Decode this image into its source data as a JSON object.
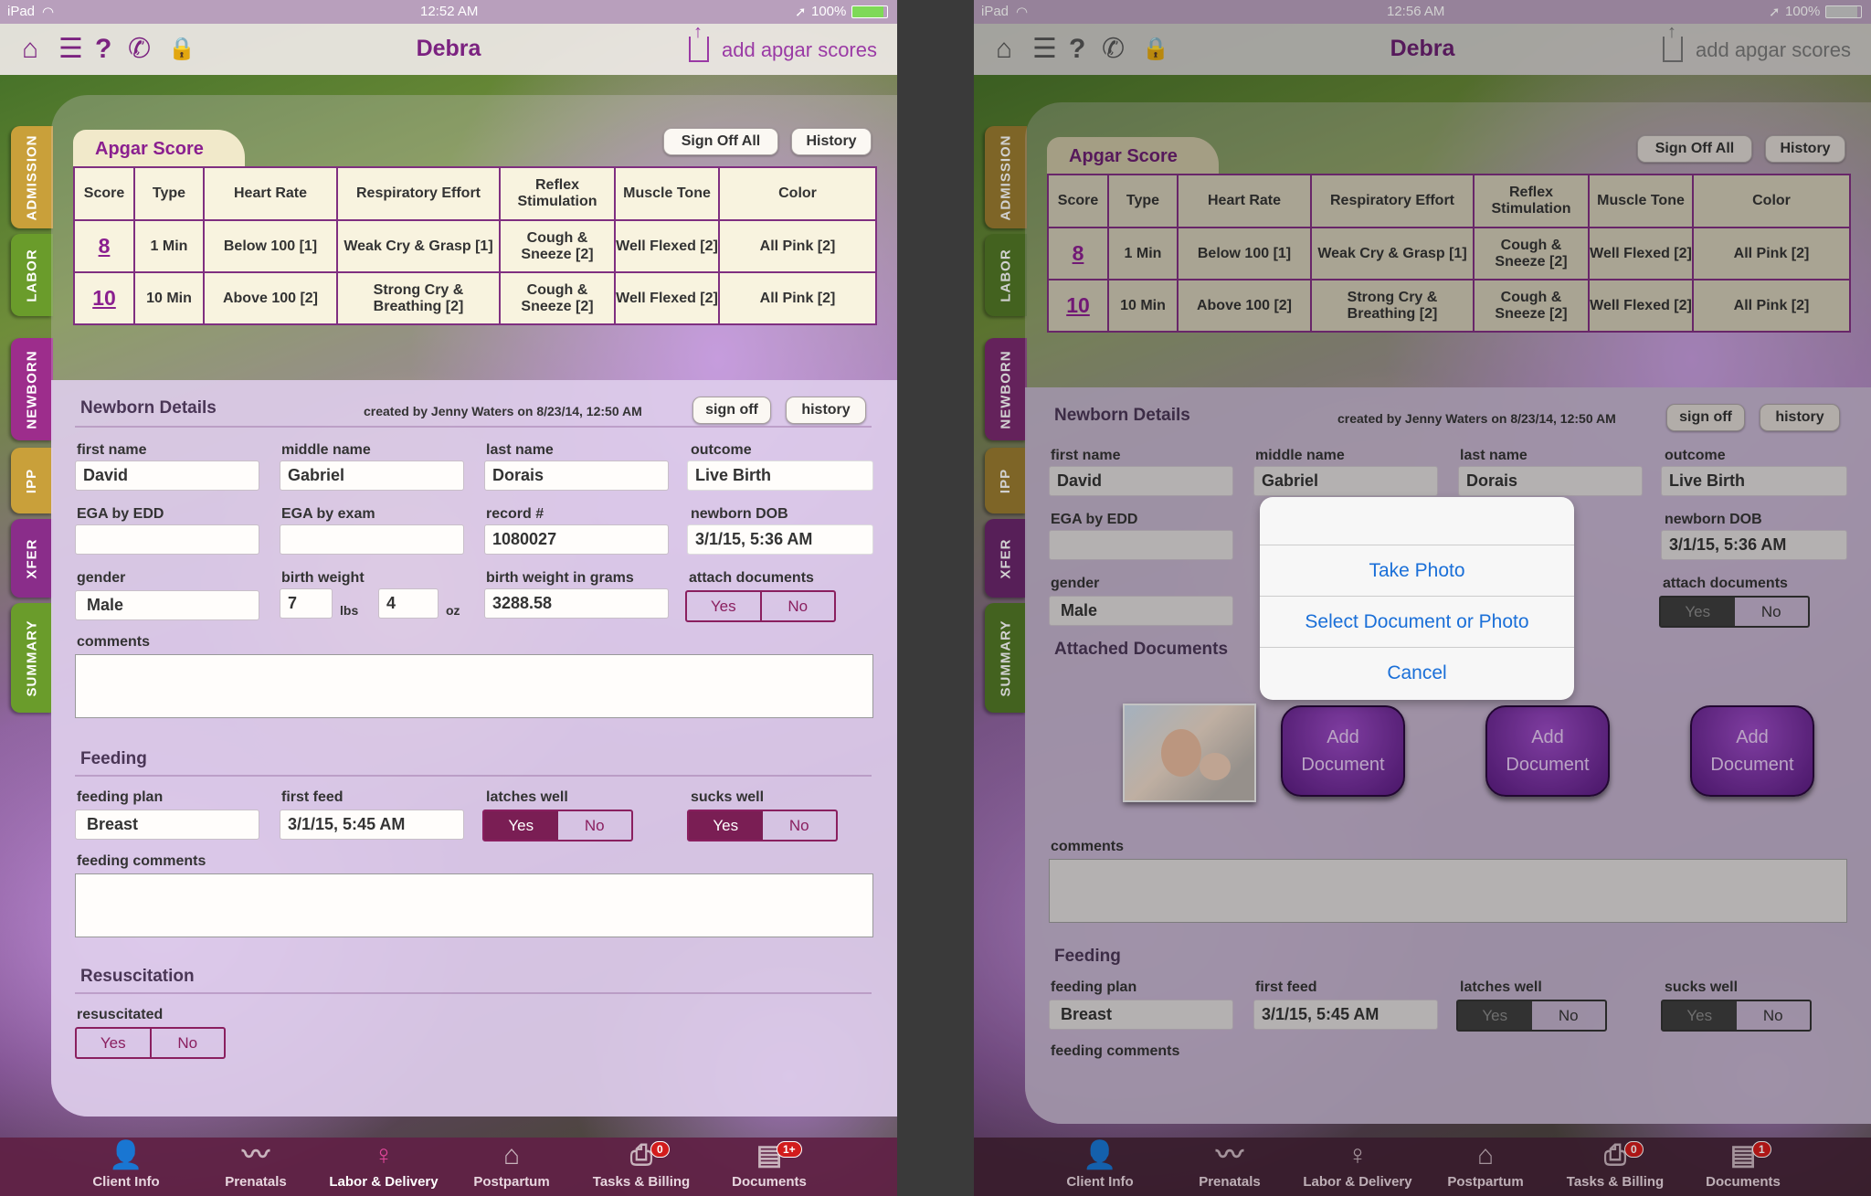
{
  "status_left": {
    "device": "iPad",
    "time": "12:52 AM",
    "battery": "100%"
  },
  "status_right": {
    "device": "iPad",
    "time": "12:56 AM",
    "battery": "100%"
  },
  "nav": {
    "title": "Debra",
    "action": "add apgar scores"
  },
  "sidetabs": [
    "ADMISSION",
    "LABOR",
    "NEWBORN",
    "IPP",
    "XFER",
    "SUMMARY"
  ],
  "apgar": {
    "title": "Apgar Score",
    "sign_off_all": "Sign Off All",
    "history": "History",
    "headers": [
      "Score",
      "Type",
      "Heart Rate",
      "Respiratory Effort",
      "Reflex Stimulation",
      "Muscle Tone",
      "Color"
    ],
    "rows": [
      [
        "8",
        "1 Min",
        "Below 100 [1]",
        "Weak Cry & Grasp [1]",
        "Cough & Sneeze [2]",
        "Well Flexed [2]",
        "All Pink [2]"
      ],
      [
        "10",
        "10 Min",
        "Above 100 [2]",
        "Strong Cry & Breathing [2]",
        "Cough & Sneeze [2]",
        "Well Flexed [2]",
        "All Pink [2]"
      ]
    ]
  },
  "newborn": {
    "title": "Newborn Details",
    "created": "created by Jenny Waters on 8/23/14, 12:50 AM",
    "sign_off": "sign off",
    "history": "history",
    "first_name_label": "first name",
    "first_name": "David",
    "middle_name_label": "middle name",
    "middle_name": "Gabriel",
    "last_name_label": "last name",
    "last_name": "Dorais",
    "outcome_label": "outcome",
    "outcome": "Live Birth",
    "ega_edd_label": "EGA by EDD",
    "ega_edd": "",
    "ega_exam_label": "EGA by exam",
    "ega_exam": "",
    "record_label": "record #",
    "record": "1080027",
    "dob_label": "newborn DOB",
    "dob": "3/1/15, 5:36 AM",
    "gender_label": "gender",
    "gender": "Male",
    "birth_weight_label": "birth weight",
    "lbs": "7",
    "lbs_unit": "lbs",
    "oz": "4",
    "oz_unit": "oz",
    "grams_label": "birth weight in grams",
    "grams": "3288.58",
    "attach_label": "attach documents",
    "yes": "Yes",
    "no": "No",
    "comments_label": "comments",
    "attached_docs_label": "Attached Documents",
    "add_document": "Add Document"
  },
  "feeding": {
    "title": "Feeding",
    "plan_label": "feeding plan",
    "plan": "Breast",
    "first_feed_label": "first feed",
    "first_feed": "3/1/15, 5:45 AM",
    "latches_label": "latches well",
    "sucks_label": "sucks well",
    "comments_label": "feeding comments"
  },
  "resuscitation": {
    "title": "Resuscitation",
    "label": "resuscitated"
  },
  "action_sheet": {
    "take_photo": "Take Photo",
    "select": "Select Document or Photo",
    "cancel": "Cancel"
  },
  "bottom_tabs": [
    {
      "label": "Client Info",
      "icon": "person-icon"
    },
    {
      "label": "Prenatals",
      "icon": "heartbeat-icon"
    },
    {
      "label": "Labor & Delivery",
      "icon": "mother-icon"
    },
    {
      "label": "Postpartum",
      "icon": "house-icon"
    },
    {
      "label": "Tasks & Billing",
      "icon": "inbox-icon",
      "badge": "0"
    },
    {
      "label": "Documents",
      "icon": "documents-icon",
      "badge": "1+",
      "badge_right": "1"
    }
  ],
  "colors": {
    "accent": "#7b2280",
    "toggle_on": "#7a1e54",
    "link_blue": "#1a6fd8"
  }
}
